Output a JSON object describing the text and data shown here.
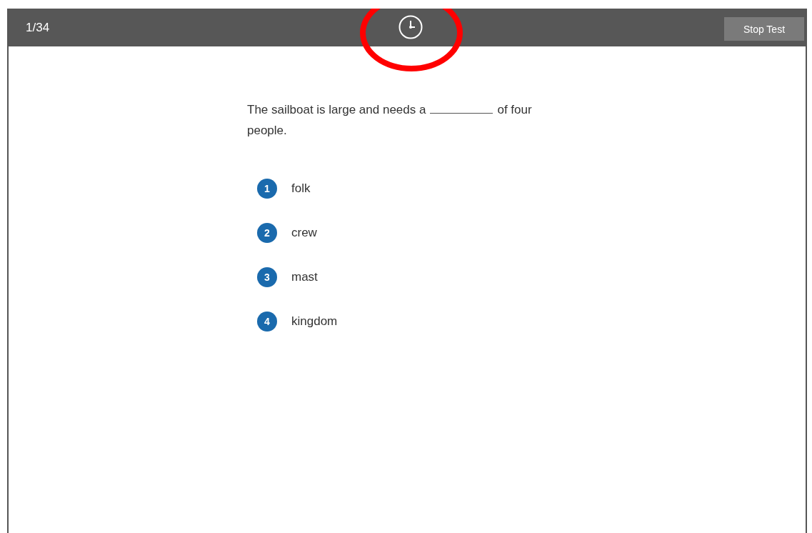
{
  "header": {
    "progress": "1/34",
    "timer_highlighted": true,
    "stop_button": "Stop Test"
  },
  "question": {
    "before_blank": "The sailboat is large and needs a",
    "after_blank": "of four",
    "second_line": "people."
  },
  "options": [
    {
      "number": "1",
      "label": "folk"
    },
    {
      "number": "2",
      "label": "crew"
    },
    {
      "number": "3",
      "label": "mast"
    },
    {
      "number": "4",
      "label": "kingdom"
    }
  ]
}
